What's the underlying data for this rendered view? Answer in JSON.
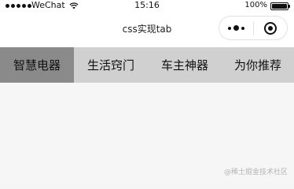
{
  "status_bar": {
    "carrier": "WeChat",
    "time": "15:16",
    "battery_percent": "100%",
    "battery_level": 1.0
  },
  "nav_bar": {
    "title": "css实现tab"
  },
  "tabs": [
    {
      "label": "智慧电器",
      "active": true
    },
    {
      "label": "生活窍门",
      "active": false
    },
    {
      "label": "车主神器",
      "active": false
    },
    {
      "label": "为你推荐",
      "active": false
    }
  ],
  "watermark": "@稀土掘金技术社区",
  "colors": {
    "active_tab": "#8a8a8a",
    "inactive_tab": "#d0d0d0",
    "page_background": "#f6f6f6"
  }
}
